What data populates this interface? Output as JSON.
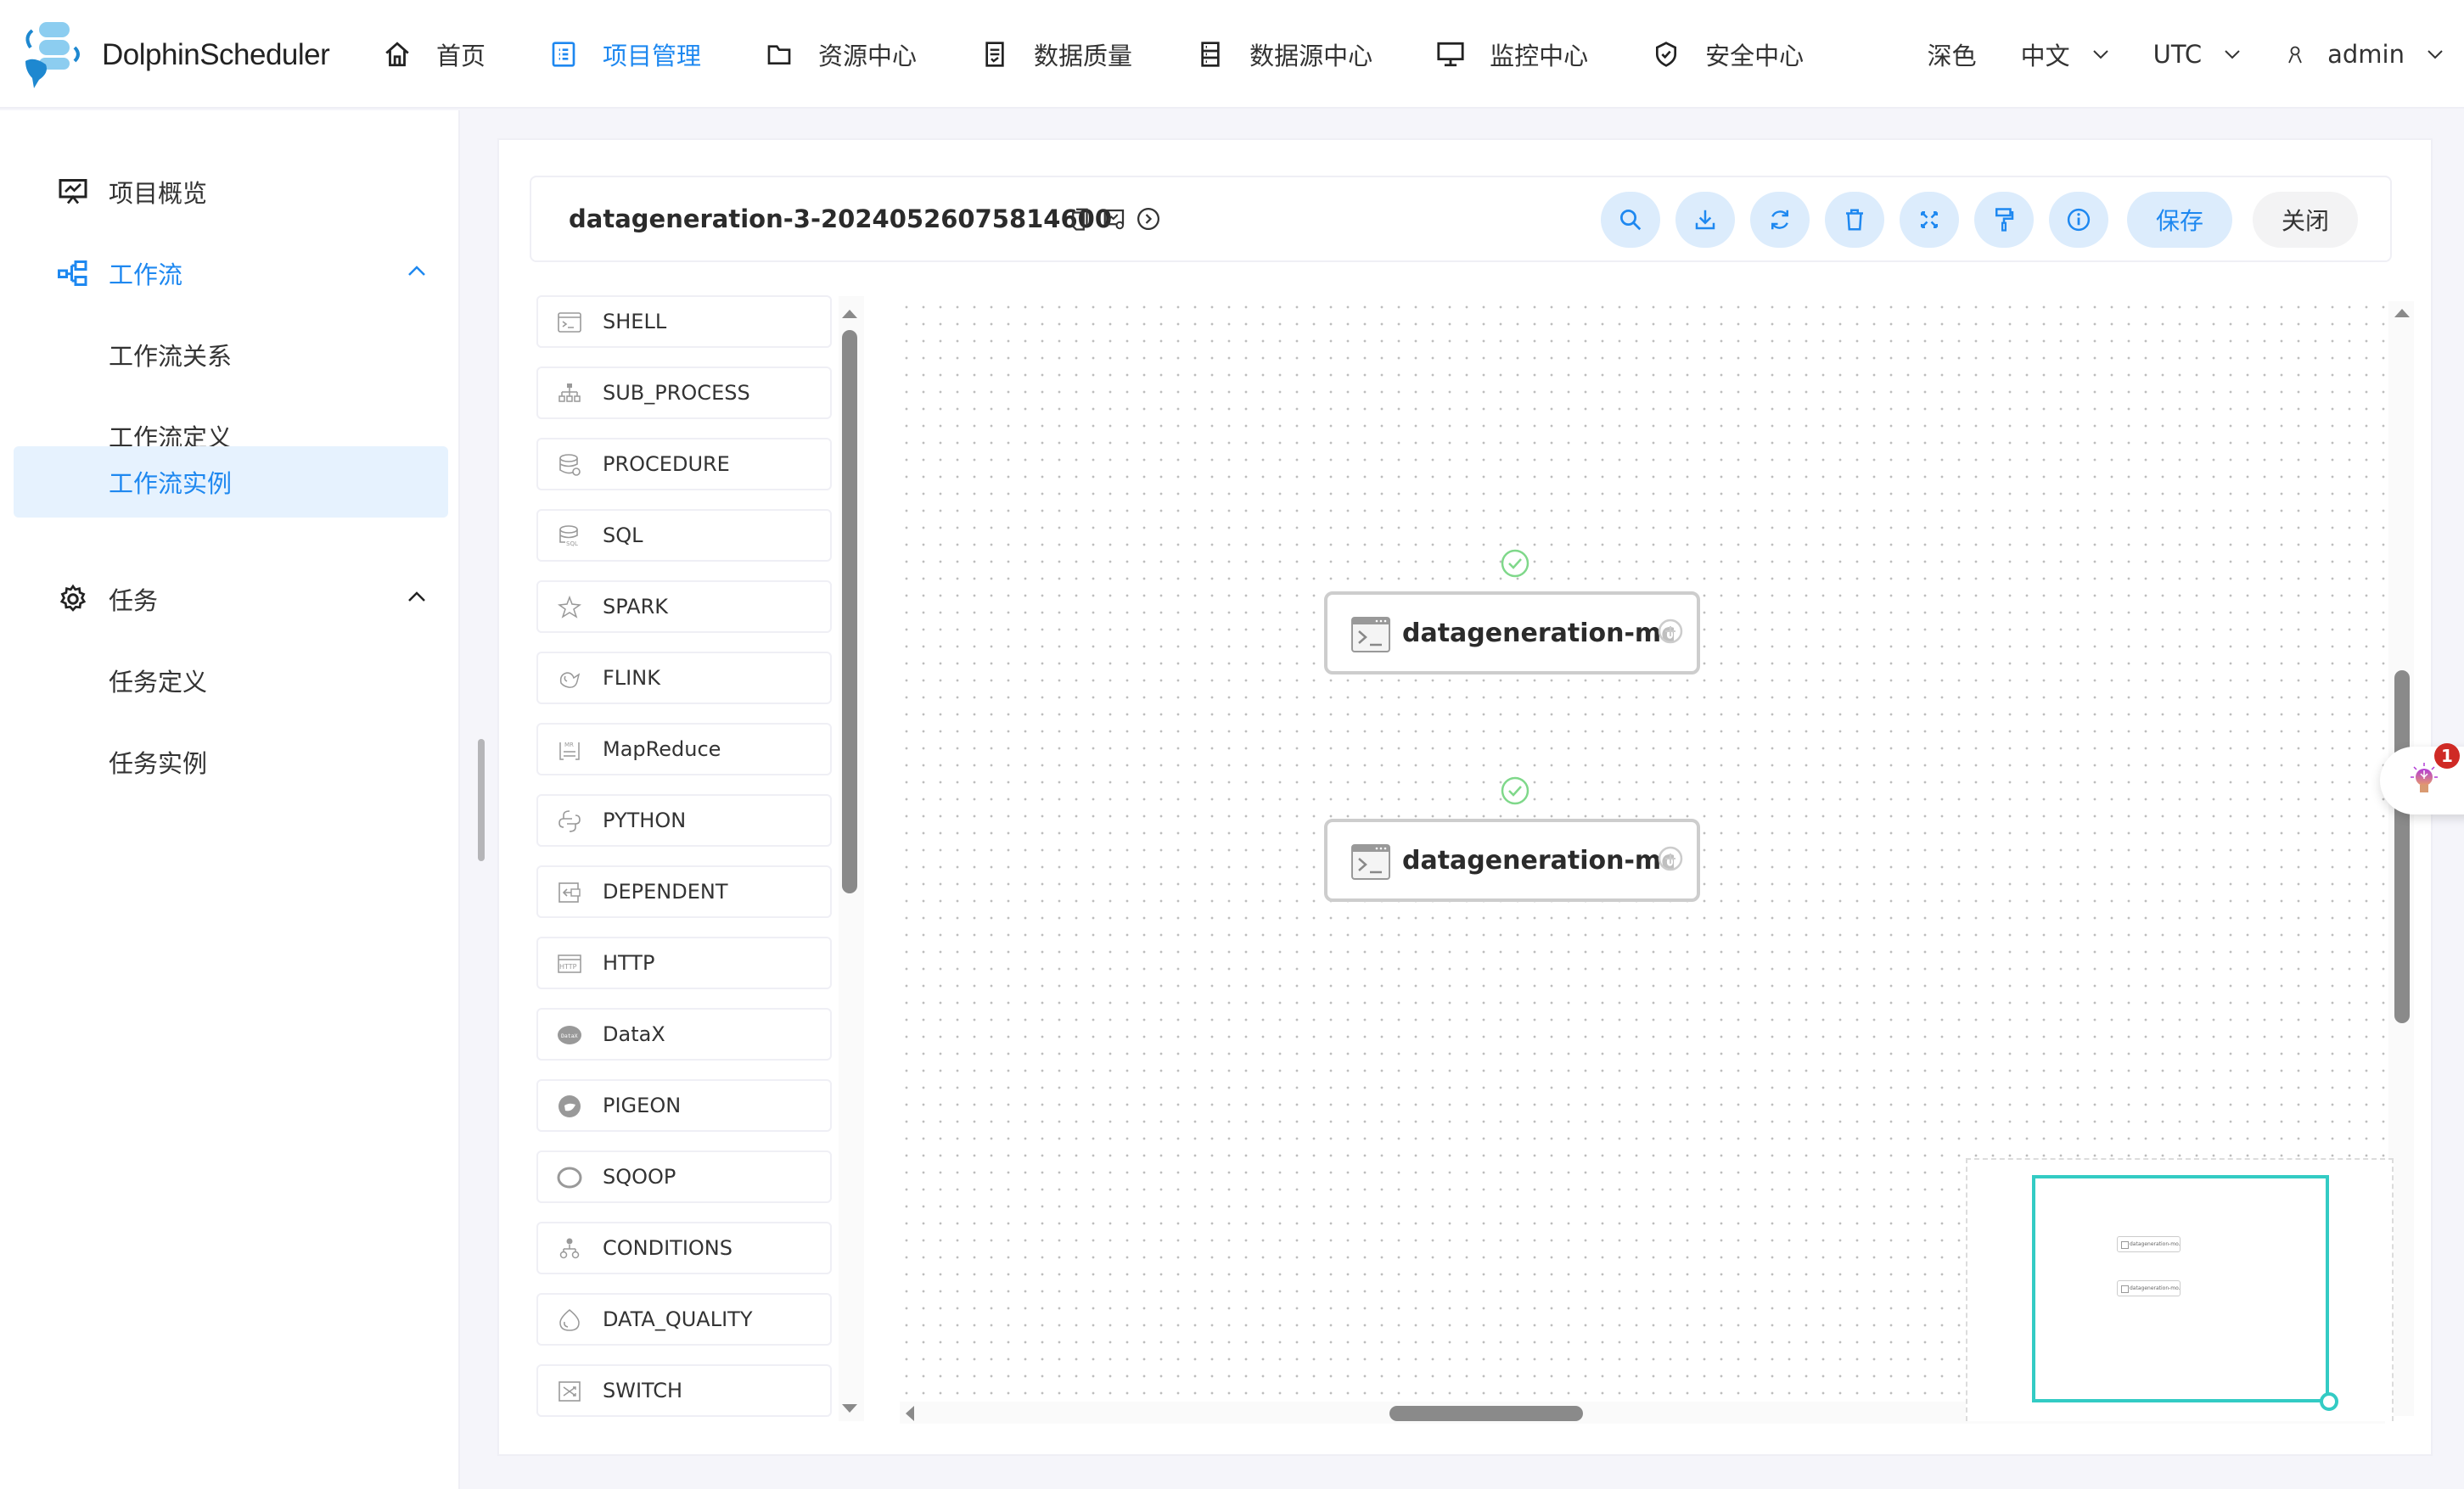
{
  "app": {
    "name": "DolphinScheduler",
    "accent_color": "#1e88f0"
  },
  "header": {
    "nav": [
      {
        "label": "首页",
        "icon": "home-icon",
        "active": false
      },
      {
        "label": "项目管理",
        "icon": "list-icon",
        "active": true
      },
      {
        "label": "资源中心",
        "icon": "folder-icon",
        "active": false
      },
      {
        "label": "数据质量",
        "icon": "checklist-icon",
        "active": false
      },
      {
        "label": "数据源中心",
        "icon": "database-icon",
        "active": false
      },
      {
        "label": "监控中心",
        "icon": "monitor-icon",
        "active": false
      },
      {
        "label": "安全中心",
        "icon": "shield-check-icon",
        "active": false
      }
    ],
    "theme_label": "深色",
    "language": "中文",
    "timezone": "UTC",
    "user": "admin"
  },
  "sidebar": {
    "items": [
      {
        "label": "项目概览",
        "icon": "presentation-chart-icon",
        "type": "item"
      },
      {
        "label": "工作流",
        "icon": "workflow-icon",
        "type": "group",
        "expanded": true,
        "active": true
      },
      {
        "label": "工作流关系",
        "type": "subitem"
      },
      {
        "label": "工作流定义",
        "type": "subitem"
      },
      {
        "label": "工作流实例",
        "type": "subitem",
        "selected": true
      },
      {
        "label": "任务",
        "icon": "gear-icon",
        "type": "group",
        "expanded": true
      },
      {
        "label": "任务定义",
        "type": "subitem"
      },
      {
        "label": "任务实例",
        "type": "subitem"
      }
    ]
  },
  "toolbar": {
    "workflow_name": "datageneration-3-20240526075814600",
    "title_icons": [
      "copy-icon",
      "view-variables-icon",
      "startup-param-icon"
    ],
    "buttons": [
      {
        "name": "search",
        "icon": "search-icon"
      },
      {
        "name": "download",
        "icon": "download-icon"
      },
      {
        "name": "refresh",
        "icon": "refresh-icon"
      },
      {
        "name": "delete",
        "icon": "delete-icon"
      },
      {
        "name": "fullscreen",
        "icon": "fullscreen-icon"
      },
      {
        "name": "format",
        "icon": "paint-roller-icon"
      },
      {
        "name": "info",
        "icon": "info-icon"
      }
    ],
    "save_label": "保存",
    "close_label": "关闭"
  },
  "palette": {
    "items": [
      {
        "label": "SHELL",
        "icon": "shell-icon"
      },
      {
        "label": "SUB_PROCESS",
        "icon": "sub-process-icon"
      },
      {
        "label": "PROCEDURE",
        "icon": "procedure-icon"
      },
      {
        "label": "SQL",
        "icon": "sql-icon"
      },
      {
        "label": "SPARK",
        "icon": "spark-icon"
      },
      {
        "label": "FLINK",
        "icon": "flink-icon"
      },
      {
        "label": "MapReduce",
        "icon": "mapreduce-icon"
      },
      {
        "label": "PYTHON",
        "icon": "python-icon"
      },
      {
        "label": "DEPENDENT",
        "icon": "dependent-icon"
      },
      {
        "label": "HTTP",
        "icon": "http-icon"
      },
      {
        "label": "DataX",
        "icon": "datax-icon"
      },
      {
        "label": "PIGEON",
        "icon": "pigeon-icon"
      },
      {
        "label": "SQOOP",
        "icon": "sqoop-icon"
      },
      {
        "label": "CONDITIONS",
        "icon": "conditions-icon"
      },
      {
        "label": "DATA_QUALITY",
        "icon": "data-quality-icon"
      },
      {
        "label": "SWITCH",
        "icon": "switch-icon"
      }
    ]
  },
  "canvas": {
    "nodes": [
      {
        "label": "datageneration-mo",
        "type": "SHELL",
        "status": "success"
      },
      {
        "label": "datageneration-mo",
        "type": "SHELL",
        "status": "success"
      }
    ],
    "status_color": "#7fd88a"
  },
  "minimap": {
    "nodes": [
      {
        "label": "datageneration-mo..."
      },
      {
        "label": "datageneration-mo..."
      }
    ],
    "viewport_color": "#33cbc4"
  },
  "floating_tip": {
    "icon": "lightbulb-icon",
    "badge_count": "1"
  }
}
